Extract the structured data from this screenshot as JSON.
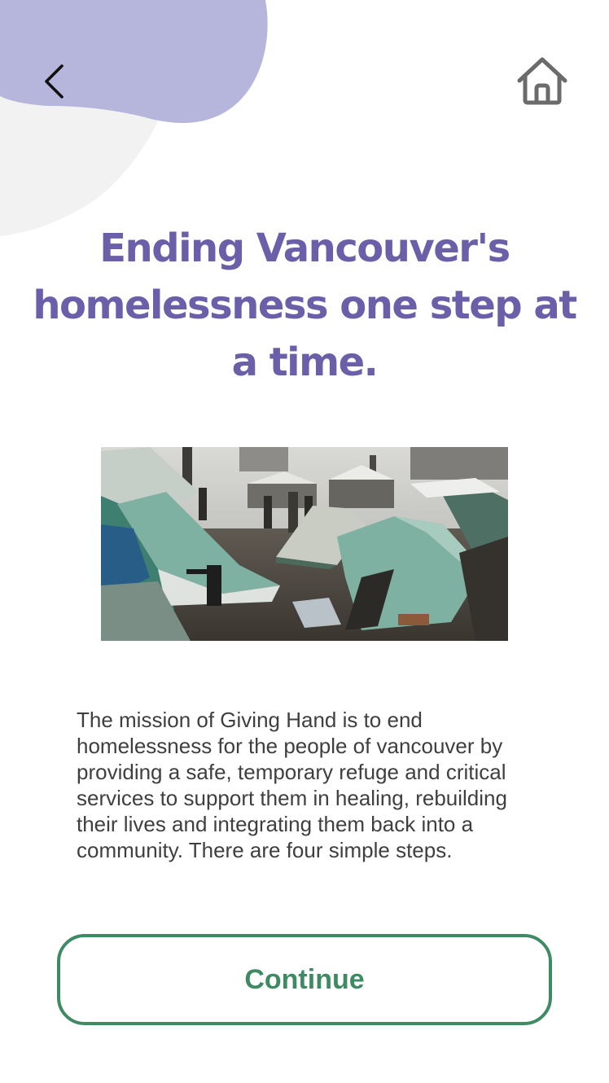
{
  "header": {
    "back_icon": "chevron-left-icon",
    "home_icon": "home-icon"
  },
  "headline": "Ending Vancouver's homelessness one step at a time.",
  "hero_image": {
    "subject": "tent-encampment-photo"
  },
  "mission_text": "The mission of Giving Hand is to end homelessness for the people of vancouver by providing a safe, temporary refuge and critical services to support them in healing, rebuilding their lives and integrating them back into a community. There are four simple steps.",
  "continue_button": {
    "label": "Continue"
  },
  "colors": {
    "accent_purple": "#6a5fa8",
    "blob_purple": "#b6b5dc",
    "blob_gray": "#f2f2f2",
    "button_green": "#3e8b63",
    "body_text": "#3f3f3f",
    "icon_gray": "#6b6b6b"
  }
}
